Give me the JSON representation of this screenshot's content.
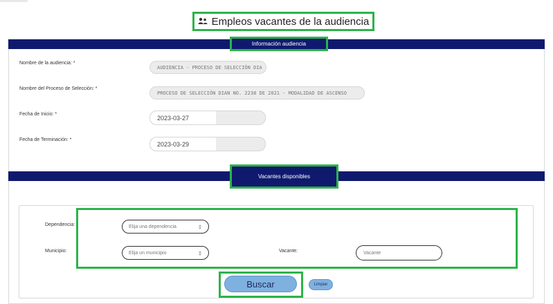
{
  "header": {
    "title": "Empleos vacantes de la audiencia",
    "icon": "users-icon"
  },
  "info_section": {
    "title": "Información audiencia",
    "fields": [
      {
        "label": "Nombre de la audiencia: *",
        "value": "AUDIENCIA - PROCESO DE SELECCIÓN DIA"
      },
      {
        "label": "Nombre del Proceso de Selección: *",
        "value": "PROCESO DE SELECCIÓN DIAN NO. 2238 DE 2021 - MODALIDAD DE ASCENSO"
      },
      {
        "label": "Fecha de Inicio: *",
        "value": "2023-03-27"
      },
      {
        "label": "Fecha de Terminación: *",
        "value": "2023-03-29"
      }
    ]
  },
  "vacantes_section": {
    "title": "Vacantes disponibles",
    "dependencia": {
      "label": "Dependencia:",
      "placeholder": "Elija una dependencia"
    },
    "municipio": {
      "label": "Municipio:",
      "placeholder": "Elija un municipio"
    },
    "vacante": {
      "label": "Vacante:",
      "placeholder": "Vacante"
    },
    "buscar_label": "Buscar",
    "limpiar_label": "Limpiar"
  },
  "colors": {
    "band": "#0f1a6e",
    "highlight": "#2db34a",
    "button": "#7fb1e0"
  }
}
